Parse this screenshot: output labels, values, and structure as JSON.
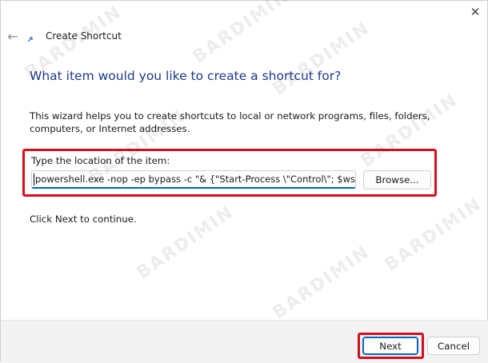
{
  "window": {
    "title": "Create Shortcut",
    "close_glyph": "✕",
    "back_glyph": "←"
  },
  "main": {
    "heading": "What item would you like to create a shortcut for?",
    "description": "This wizard helps you to create shortcuts to local or network programs, files, folders, computers, or Internet addresses.",
    "field_label": "Type the location of the item:",
    "location_value": "powershell.exe -nop -ep bypass -c \"& {\"Start-Process \\\"Control\\\"; $wshell = ",
    "browse_label": "Browse...",
    "continue_text": "Click Next to continue."
  },
  "footer": {
    "next_label": "Next",
    "cancel_label": "Cancel"
  },
  "watermark": "BARDIMIN",
  "colors": {
    "heading": "#1c3a8c",
    "highlight": "#d3101e",
    "accent": "#0067c0"
  },
  "icons": [
    "close-icon",
    "back-arrow-icon",
    "shortcut-icon"
  ]
}
